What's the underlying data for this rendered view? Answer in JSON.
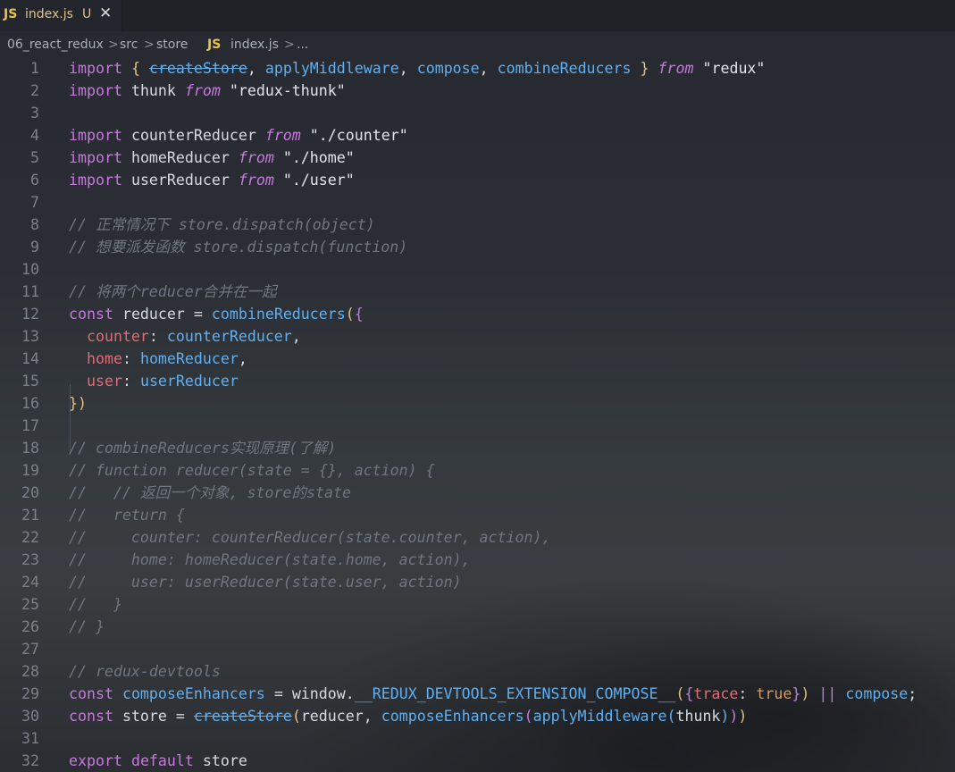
{
  "tab": {
    "icon": "JS",
    "filename": "index.js",
    "modified": "U",
    "close_icon": "✕"
  },
  "breadcrumb": {
    "items": [
      "06_react_redux",
      "src",
      "store",
      "index.js",
      "..."
    ],
    "file_icon": "JS",
    "separator": ">"
  },
  "colors": {
    "keyword": "#c678dd",
    "function": "#61afef",
    "string": "#e1e6eb",
    "comment": "#6f7680",
    "property": "#e06c75",
    "boolean": "#d19a66",
    "tab_title": "#e2c08d"
  },
  "editor": {
    "lines": [
      {
        "n": "1",
        "text": "import { createStore, applyMiddleware, compose, combineReducers } from \"redux\""
      },
      {
        "n": "2",
        "text": "import thunk from \"redux-thunk\""
      },
      {
        "n": "3",
        "text": ""
      },
      {
        "n": "4",
        "text": "import counterReducer from \"./counter\""
      },
      {
        "n": "5",
        "text": "import homeReducer from \"./home\""
      },
      {
        "n": "6",
        "text": "import userReducer from \"./user\""
      },
      {
        "n": "7",
        "text": ""
      },
      {
        "n": "8",
        "text": "// 正常情况下 store.dispatch(object)"
      },
      {
        "n": "9",
        "text": "// 想要派发函数 store.dispatch(function)"
      },
      {
        "n": "10",
        "text": ""
      },
      {
        "n": "11",
        "text": "// 将两个reducer合并在一起"
      },
      {
        "n": "12",
        "text": "const reducer = combineReducers({"
      },
      {
        "n": "13",
        "text": "  counter: counterReducer,"
      },
      {
        "n": "14",
        "text": "  home: homeReducer,"
      },
      {
        "n": "15",
        "text": "  user: userReducer"
      },
      {
        "n": "16",
        "text": "})"
      },
      {
        "n": "17",
        "text": ""
      },
      {
        "n": "18",
        "text": "// combineReducers实现原理(了解)"
      },
      {
        "n": "19",
        "text": "// function reducer(state = {}, action) {"
      },
      {
        "n": "20",
        "text": "//   // 返回一个对象, store的state"
      },
      {
        "n": "21",
        "text": "//   return {"
      },
      {
        "n": "22",
        "text": "//     counter: counterReducer(state.counter, action),"
      },
      {
        "n": "23",
        "text": "//     home: homeReducer(state.home, action),"
      },
      {
        "n": "24",
        "text": "//     user: userReducer(state.user, action)"
      },
      {
        "n": "25",
        "text": "//   }"
      },
      {
        "n": "26",
        "text": "// }"
      },
      {
        "n": "27",
        "text": ""
      },
      {
        "n": "28",
        "text": "// redux-devtools"
      },
      {
        "n": "29",
        "text": "const composeEnhancers = window.__REDUX_DEVTOOLS_EXTENSION_COMPOSE__({trace: true}) || compose;"
      },
      {
        "n": "30",
        "text": "const store = createStore(reducer, composeEnhancers(applyMiddleware(thunk)))"
      },
      {
        "n": "31",
        "text": ""
      },
      {
        "n": "32",
        "text": "export default store"
      }
    ]
  }
}
